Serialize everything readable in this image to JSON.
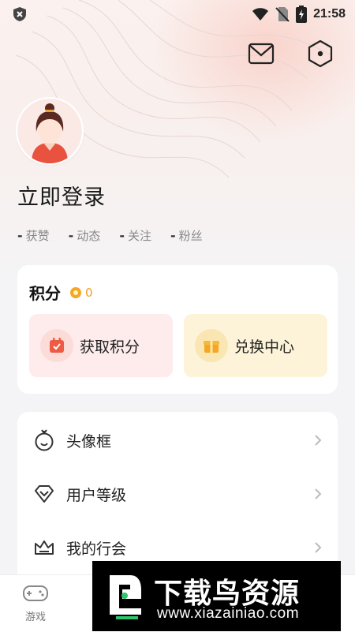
{
  "status_bar": {
    "time": "21:58",
    "icons": [
      "shield-x-icon",
      "wifi-icon",
      "no-sim-icon",
      "battery-charging-icon"
    ]
  },
  "header": {
    "icons": [
      "mail-icon",
      "settings-hex-icon"
    ]
  },
  "profile": {
    "login_text": "立即登录",
    "stats": [
      {
        "value": "-",
        "label": "获赞"
      },
      {
        "value": "-",
        "label": "动态"
      },
      {
        "value": "-",
        "label": "关注"
      },
      {
        "value": "-",
        "label": "粉丝"
      }
    ]
  },
  "points": {
    "title": "积分",
    "value": "0",
    "earn_label": "获取积分",
    "exchange_label": "兑换中心"
  },
  "menu": {
    "items": [
      {
        "label": "头像框",
        "icon": "avatar-frame-icon"
      },
      {
        "label": "用户等级",
        "icon": "level-diamond-icon"
      },
      {
        "label": "我的行会",
        "icon": "guild-crown-icon"
      }
    ]
  },
  "tabbar": {
    "game_label": "游戏"
  },
  "watermark": {
    "title": "下载鸟资源",
    "url": "www.xiazainiao.com"
  },
  "colors": {
    "accent_orange": "#f0a020",
    "earn_tile": "#fdeceb",
    "exchange_tile": "#fdf3d9"
  }
}
